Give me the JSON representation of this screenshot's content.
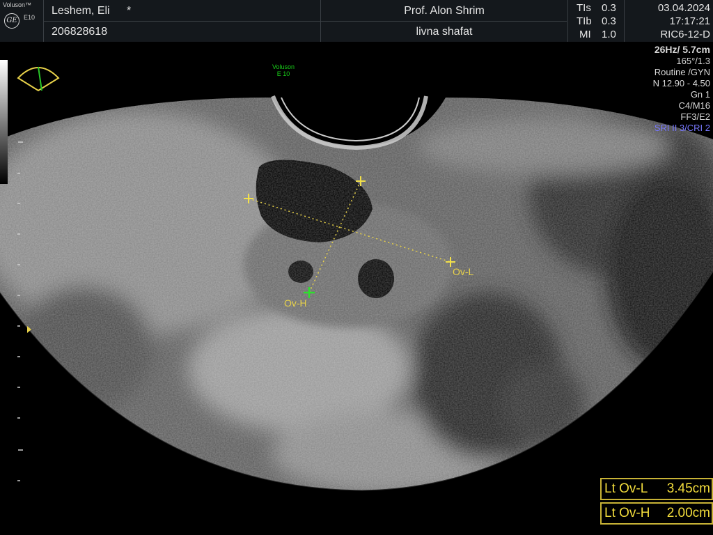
{
  "header": {
    "brand": "Voluson™",
    "brand_sub": "E10",
    "logo": "GE",
    "patient_name": "Leshem, Eli",
    "patient_flag": "*",
    "patient_id": "206828618",
    "physician": "Prof. Alon Shrim",
    "institution": "livna shafat",
    "tis_label": "TIs",
    "tis_value": "0.3",
    "tib_label": "TIb",
    "tib_value": "0.3",
    "mi_label": "MI",
    "mi_value": "1.0",
    "date": "03.04.2024",
    "time": "17:17:21",
    "probe": "RIC6-12-D"
  },
  "params": {
    "frame_depth": "26Hz/ 5.7cm",
    "angle": "165°/1.3",
    "preset": "Routine /GYN",
    "freq": "N 12.90 - 4.50",
    "gain": "Gn  1",
    "cm": "C4/M16",
    "ff": "FF3/E2",
    "sri": "SRI II 3/CRI 2"
  },
  "watermark": {
    "line1": "Voluson",
    "line2": "E 10"
  },
  "calipers": {
    "label_l": "Ov-L",
    "label_h": "Ov-H"
  },
  "measurements": [
    {
      "label": "Lt Ov-L",
      "value": "3.45cm"
    },
    {
      "label": "Lt Ov-H",
      "value": "2.00cm"
    }
  ],
  "colors": {
    "caliper_yellow": "#f0e040",
    "caliper_green": "#2de02d",
    "sri_blue": "#7878ff",
    "measure_text": "#f2dc3c"
  }
}
